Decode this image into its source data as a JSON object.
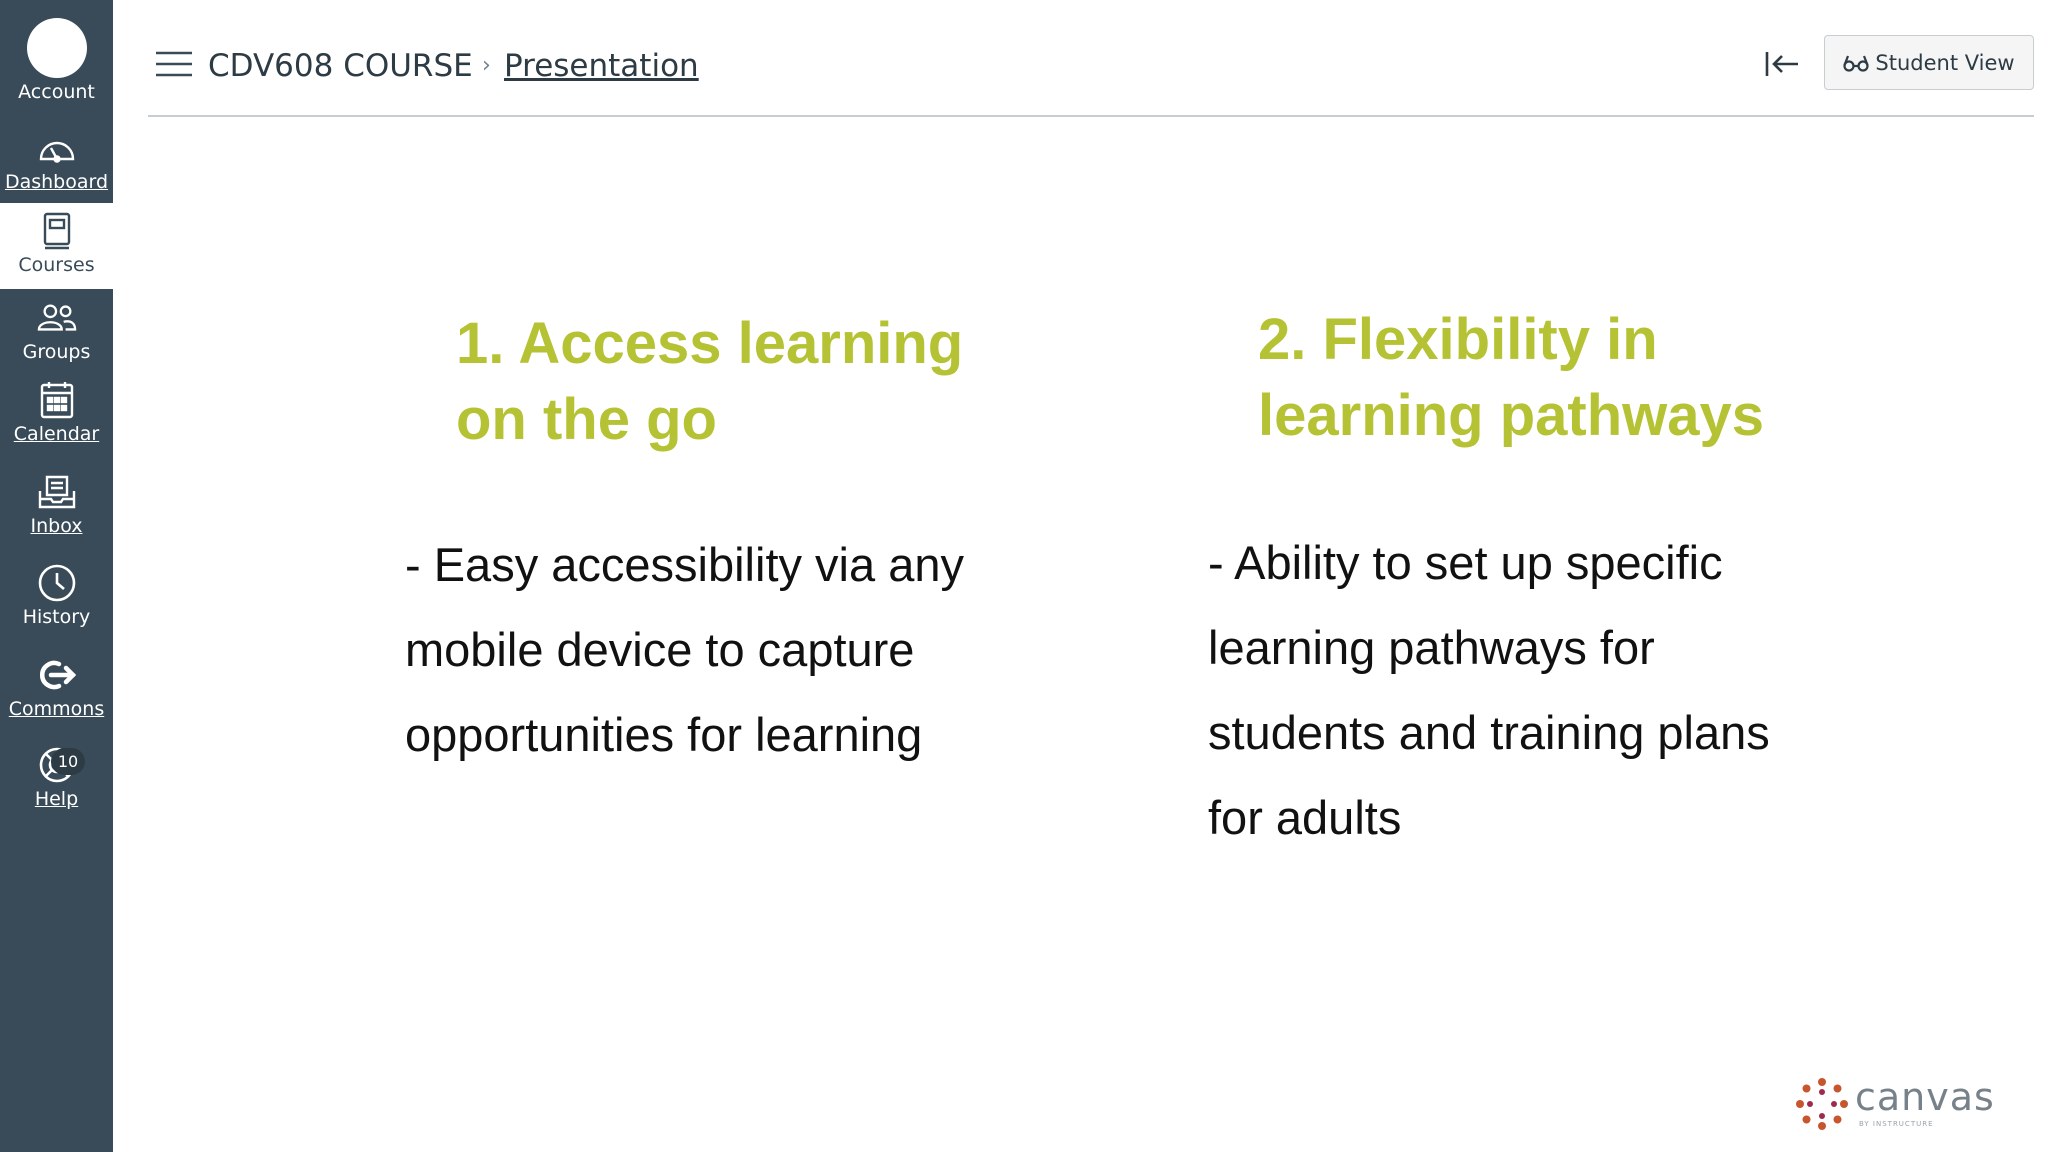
{
  "nav": {
    "account": "Account",
    "dashboard": "Dashboard",
    "courses": "Courses",
    "groups": "Groups",
    "calendar": "Calendar",
    "inbox": "Inbox",
    "history": "History",
    "commons": "Commons",
    "help": "Help",
    "help_badge": "10"
  },
  "header": {
    "course": "CDV608 COURSE",
    "separator": "›",
    "page": "Presentation",
    "student_view": "Student View"
  },
  "slide": {
    "col1": {
      "heading_line1": "1. Access learning",
      "heading_line2": "on the go",
      "body_line1": "- Easy accessibility via any",
      "body_line2": "mobile device to capture",
      "body_line3": "opportunities for learning"
    },
    "col2": {
      "heading_line1": "2. Flexibility in",
      "heading_line2": "learning pathways",
      "body_line1": "- Ability to set up specific",
      "body_line2": "learning pathways for",
      "body_line3": "students and training plans",
      "body_line4": "for adults"
    }
  },
  "logo": {
    "word": "canvas",
    "sub": "BY INSTRUCTURE"
  },
  "colors": {
    "sidebar": "#394B58",
    "accent_heading": "#B5C234",
    "text": "#2D3B45"
  },
  "icons": [
    "avatar",
    "dashboard-icon",
    "courses-icon",
    "groups-icon",
    "calendar-icon",
    "inbox-icon",
    "history-icon",
    "commons-icon",
    "help-icon",
    "hamburger-menu-icon",
    "collapse-left-icon",
    "glasses-icon",
    "canvas-logo"
  ]
}
